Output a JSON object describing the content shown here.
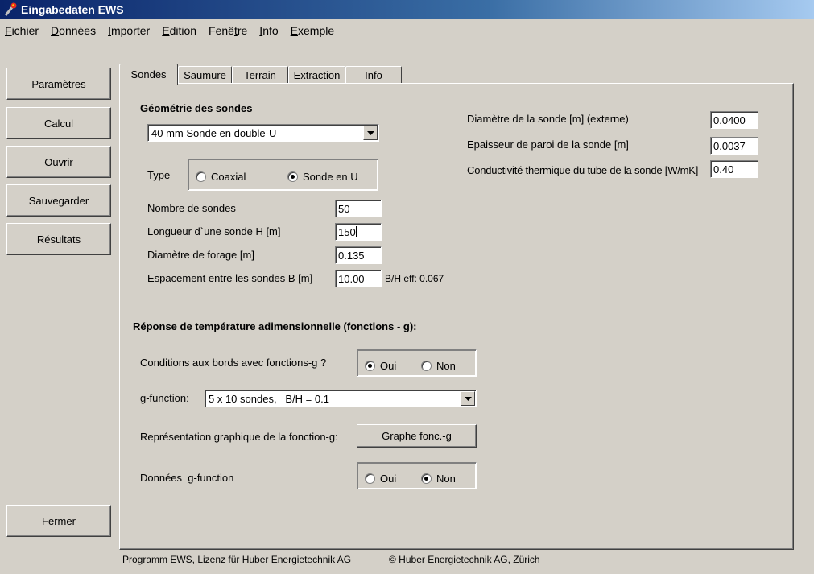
{
  "window": {
    "title": "Eingabedaten EWS"
  },
  "menu": [
    {
      "pre": "",
      "mn": "F",
      "post": "ichier"
    },
    {
      "pre": "",
      "mn": "D",
      "post": "onnées"
    },
    {
      "pre": "",
      "mn": "I",
      "post": "mporter"
    },
    {
      "pre": "",
      "mn": "E",
      "post": "dition"
    },
    {
      "pre": "Fenê",
      "mn": "t",
      "post": "re"
    },
    {
      "pre": "",
      "mn": "I",
      "post": "nfo"
    },
    {
      "pre": "",
      "mn": "E",
      "post": "xemple"
    }
  ],
  "sidebar": {
    "parametres": "Paramètres",
    "calcul": "Calcul",
    "ouvrir": "Ouvrir",
    "sauvegarder": "Sauvegarder",
    "resultats": "Résultats",
    "fermer": "Fermer"
  },
  "tabs": {
    "sondes": "Sondes",
    "saumure": "Saumure",
    "terrain": "Terrain",
    "extraction": "Extraction",
    "info": "Info"
  },
  "geometry": {
    "heading": "Géométrie des sondes",
    "probe_type_value": "40 mm Sonde en double-U",
    "type_label": "Type",
    "coaxial_label": "Coaxial",
    "sonde_u_label": "Sonde en U",
    "selected_type": "Sonde en U",
    "nombre_label": "Nombre de sondes",
    "nombre_value": "50",
    "longueur_label": "Longueur d`une sonde H [m]",
    "longueur_value": "150",
    "diametre_forage_label": "Diamètre de forage [m]",
    "diametre_forage_value": "0.135",
    "espacement_label": "Espacement entre les sondes B [m]",
    "espacement_value": "10.00",
    "bh_eff_label": "B/H eff:",
    "bh_eff_value": "0.067"
  },
  "pipe": {
    "diametre_label": "Diamètre de la sonde [m] (externe)",
    "diametre_value": "0.0400",
    "epaisseur_label": "Epaisseur de paroi de la sonde [m]",
    "epaisseur_value": "0.0037",
    "conductivite_label": "Conductivité thermique du tube de la sonde [W/mK]",
    "conductivite_value": "0.40"
  },
  "gfunc": {
    "heading": "Réponse de température adimensionnelle (fonctions - g):",
    "conditions_label": "Conditions aux bords avec fonctions-g ?",
    "oui": "Oui",
    "non": "Non",
    "conditions_selected": "Oui",
    "gfunction_label": "g-function:",
    "gfunction_value": "5 x 10 sondes,   B/H = 0.1",
    "graph_label": "Représentation graphique de la fonction-g:",
    "graph_button": "Graphe fonc.-g",
    "donnees_label": "Données  g-function",
    "donnees_selected": "Non"
  },
  "footer": {
    "license": "Programm EWS, Lizenz für Huber Energietechnik AG",
    "copyright": "© Huber Energietechnik AG, Zürich"
  }
}
